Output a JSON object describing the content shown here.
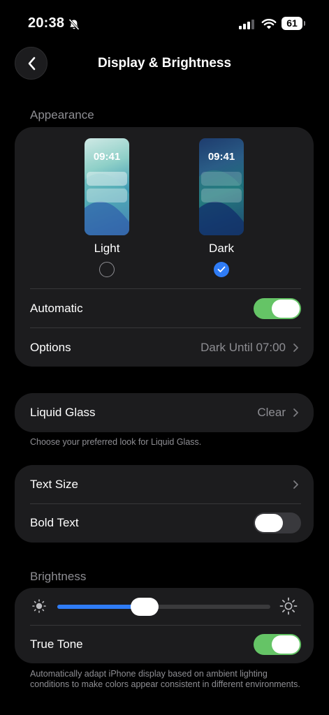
{
  "status": {
    "time": "20:38",
    "battery": "61"
  },
  "nav": {
    "title": "Display & Brightness"
  },
  "appearance": {
    "header": "Appearance",
    "light": {
      "label": "Light",
      "preview_time": "09:41",
      "selected": false
    },
    "dark": {
      "label": "Dark",
      "preview_time": "09:41",
      "selected": true
    },
    "automatic": {
      "label": "Automatic",
      "on": true
    },
    "options": {
      "label": "Options",
      "value": "Dark Until 07:00"
    }
  },
  "liquid_glass": {
    "label": "Liquid Glass",
    "value": "Clear",
    "footnote": "Choose your preferred look for Liquid Glass."
  },
  "text": {
    "text_size_label": "Text Size",
    "bold_text_label": "Bold Text",
    "bold_text_on": false
  },
  "brightness": {
    "header": "Brightness",
    "level_percent": 41,
    "true_tone_label": "True Tone",
    "true_tone_on": true,
    "footnote": "Automatically adapt iPhone display based on ambient lighting conditions to make colors appear consistent in different environments."
  },
  "colors": {
    "accent": "#2f7cf6",
    "toggle_on": "#65c466",
    "card_bg": "#1c1c1e",
    "secondary_text": "#8e8e93"
  },
  "icons": {
    "back": "chevron-left-icon",
    "silent": "bell-slash-icon",
    "signal": "cellular-signal-icon",
    "wifi": "wifi-icon",
    "sun_small": "sun-small-icon",
    "sun_large": "sun-large-icon",
    "check": "checkmark-icon",
    "chevron": "chevron-right-icon"
  }
}
